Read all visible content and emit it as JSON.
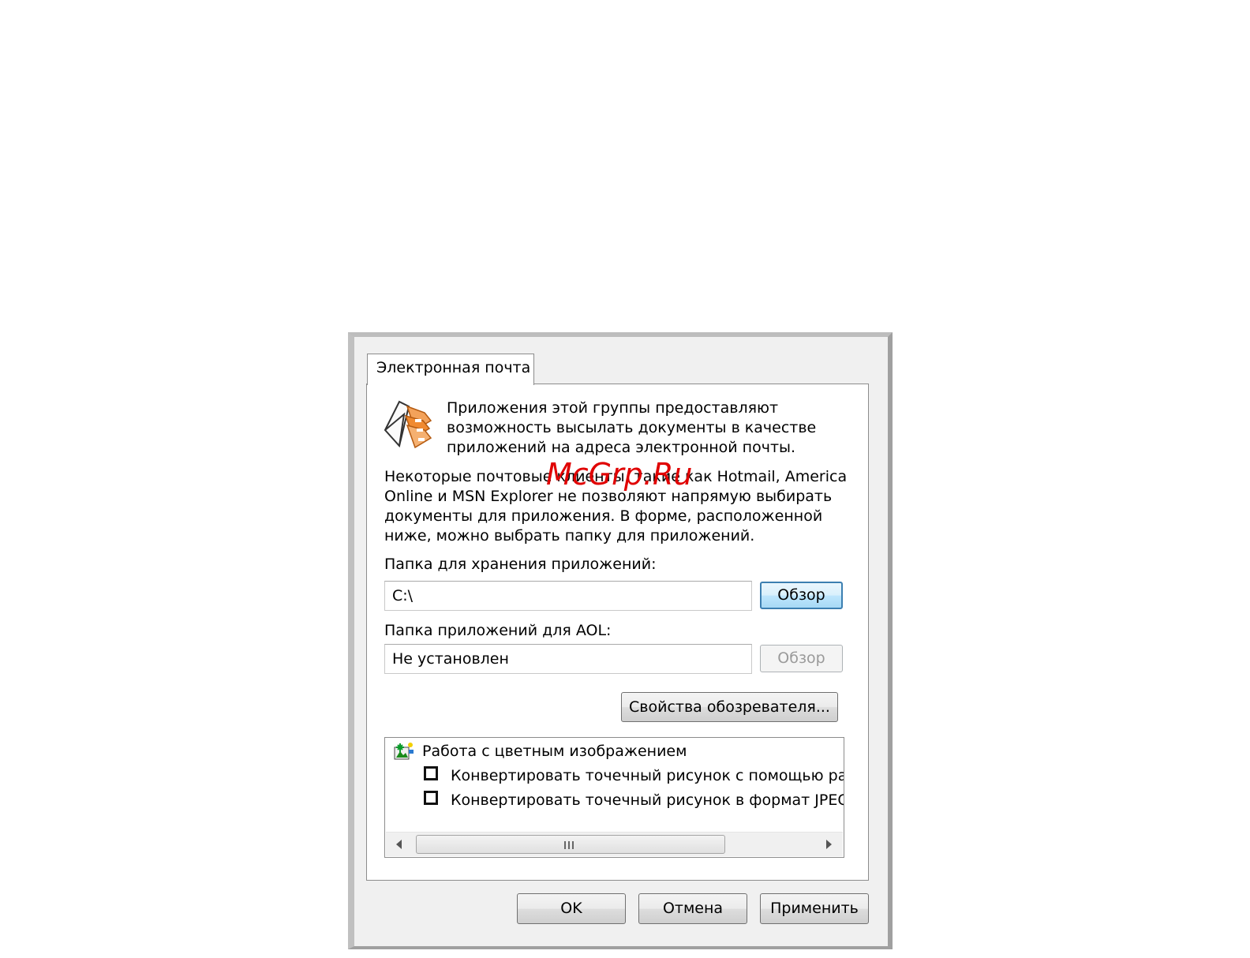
{
  "tab": {
    "label": "Электронная почта"
  },
  "intro": {
    "line1": "Приложения этой группы предоставляют",
    "line2": "возможность высылать документы в качестве",
    "line3": "приложений на адреса электронной почты."
  },
  "note": {
    "line1": "Некоторые почтовые клиенты, такие как Hotmail, America",
    "line2": "Online и MSN Explorer не позволяют напрямую выбирать",
    "line3": "документы для приложения. В форме, расположенной",
    "line4": "ниже, можно выбрать папку для приложений."
  },
  "attachments_folder": {
    "label": "Папка для хранения приложений:",
    "value": "C:\\",
    "browse_label": "Обзор"
  },
  "aol_folder": {
    "label": "Папка приложений для AOL:",
    "value": "Не установлен",
    "browse_label": "Обзор"
  },
  "browser_properties_label": "Свойства обозревателя...",
  "color_options": {
    "group_label": "Работа с цветным изображением",
    "items": [
      {
        "label": "Конвертировать точечный рисунок с помощью раз",
        "checked": false
      },
      {
        "label": "Конвертировать точечный рисунок в формат JPEG",
        "checked": false
      }
    ]
  },
  "buttons": {
    "ok": "OK",
    "cancel": "Отмена",
    "apply": "Применить"
  },
  "watermark": "McGrp.Ru"
}
